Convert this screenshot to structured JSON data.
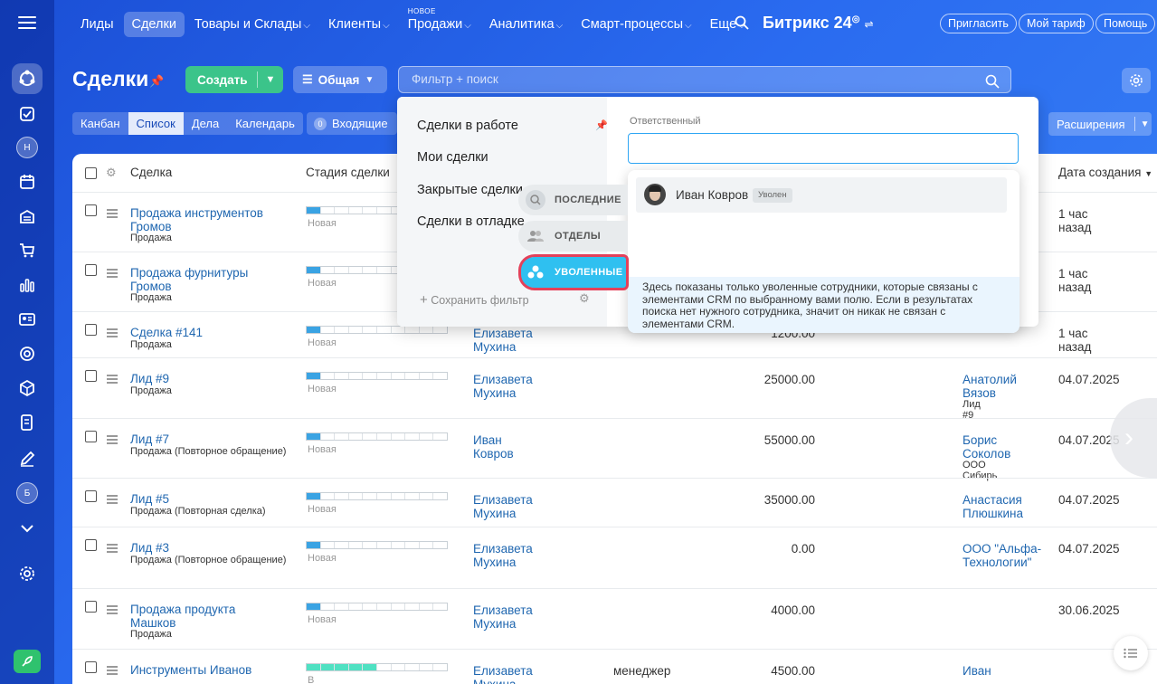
{
  "topnav": {
    "items": [
      {
        "label": "Лиды",
        "caret": false,
        "badge": ""
      },
      {
        "label": "Сделки",
        "caret": false,
        "badge": "",
        "active": true
      },
      {
        "label": "Товары и Склады",
        "caret": true,
        "badge": ""
      },
      {
        "label": "Клиенты",
        "caret": true,
        "badge": ""
      },
      {
        "label": "Продажи",
        "caret": true,
        "badge": "НОВОЕ"
      },
      {
        "label": "Аналитика",
        "caret": true,
        "badge": ""
      },
      {
        "label": "Смарт-процессы",
        "caret": true,
        "badge": ""
      },
      {
        "label": "Еще",
        "caret": true,
        "badge": ""
      }
    ],
    "brand": "Битрикс 24",
    "invite": "Пригласить",
    "tariff": "Мой тариф",
    "help": "Помощь"
  },
  "rail": {
    "avatar1": "Н",
    "avatar2": "Б"
  },
  "header": {
    "title": "Сделки",
    "create": "Создать",
    "preset": "Общая",
    "search_placeholder": "Фильтр + поиск"
  },
  "views": {
    "tabs": [
      "Канбан",
      "Список",
      "Дела",
      "Календарь"
    ],
    "active": "Список",
    "incoming_count": "0",
    "incoming_label": "Входящие",
    "extensions": "Расширения"
  },
  "table": {
    "col_deal": "Сделка",
    "col_stage": "Стадия сделки",
    "col_created": "Дата создания",
    "rows": [
      {
        "name": "Продажа инструментов Громов",
        "sub": "Продажа",
        "stage": "Новая",
        "resp": "",
        "amount": "",
        "client": "",
        "client_sub": "",
        "created": "1 час назад"
      },
      {
        "name": "Продажа фурнитуры Громов",
        "sub": "Продажа",
        "stage": "Новая",
        "resp": "",
        "amount": "",
        "client": "",
        "client_sub": "",
        "created": "1 час назад"
      },
      {
        "name": "Сделка #141",
        "sub": "Продажа",
        "stage": "Новая",
        "resp": "Елизавета Мухина",
        "amount": "1200.00",
        "client": "",
        "client_sub": "",
        "created": "1 час назад"
      },
      {
        "name": "Лид #9",
        "sub": "Продажа",
        "stage": "Новая",
        "resp": "Елизавета Мухина",
        "amount": "25000.00",
        "client": "Анатолий Вязов",
        "client_sub": "Лид #9",
        "created": "04.07.2025"
      },
      {
        "name": "Лид #7",
        "sub": "Продажа (Повторное обращение)",
        "stage": "Новая",
        "resp": "Иван Ковров",
        "amount": "55000.00",
        "client": "Борис Соколов",
        "client_sub": "ООО Сибирь",
        "created": "04.07.2025"
      },
      {
        "name": "Лид #5",
        "sub": "Продажа (Повторная сделка)",
        "stage": "Новая",
        "resp": "Елизавета Мухина",
        "amount": "35000.00",
        "client": "Анастасия Плюшкина",
        "client_sub": "",
        "created": "04.07.2025"
      },
      {
        "name": "Лид #3",
        "sub": "Продажа (Повторное обращение)",
        "stage": "Новая",
        "resp": "Елизавета Мухина",
        "amount": "0.00",
        "client": "ООО \"Альфа-Технологии\"",
        "client_sub": "",
        "created": "04.07.2025"
      },
      {
        "name": "Продажа продукта Машков",
        "sub": "Продажа",
        "stage": "Новая",
        "resp": "Елизавета Мухина",
        "amount": "4000.00",
        "client": "",
        "client_sub": "",
        "created": "30.06.2025"
      },
      {
        "name": "Инструменты Иванов",
        "sub": "",
        "stage": "В работе",
        "resp": "Елизавета Мухина",
        "extra": "менеджер",
        "amount": "4500.00",
        "client": "Иван",
        "client_sub": "",
        "created": ""
      }
    ]
  },
  "filter": {
    "presets": [
      "Сделки в работе",
      "Мои сделки",
      "Закрытые сделки",
      "Сделки в отладке"
    ],
    "save": "Сохранить фильтр",
    "field_label": "Ответственный",
    "categories": {
      "recent": "ПОСЛЕДНИЕ",
      "depts": "ОТДЕЛЫ",
      "fired": "УВОЛЕННЫЕ"
    },
    "employee": {
      "name": "Иван Ковров",
      "badge": "Уволен"
    },
    "note": "Здесь показаны только уволенные сотрудники, которые связаны с элементами CRM по выбранному вами полю. Если в результатах поиска нет нужного сотрудника, значит он никак не связан с элементами CRM."
  },
  "colors": {
    "accent": "#2fc0f0",
    "create": "#3bc48a",
    "highlight": "#e4415a",
    "link": "#2067b0"
  }
}
